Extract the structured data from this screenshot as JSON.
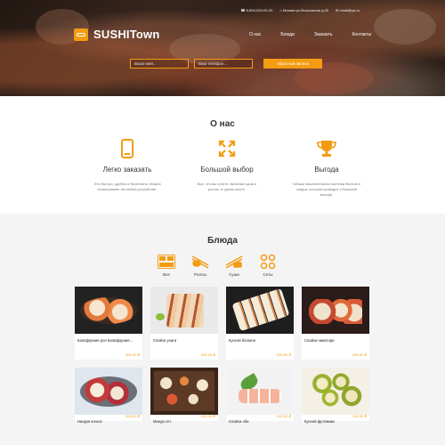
{
  "header": {
    "phone": "8-800-000-00-00",
    "address": "Москва ул.Московская д.00",
    "email": "email@ya.ru",
    "logo_text": "SUSHITown",
    "nav": [
      "О нас",
      "Блюда",
      "Заказать",
      "Контакты"
    ],
    "name_placeholder": "Ваше имя...",
    "phone_placeholder": "Ваш телефон...",
    "callback_button": "обратный звонок"
  },
  "about": {
    "title": "О нас",
    "features": [
      {
        "icon": "phone-icon",
        "title": "Легко заказать",
        "text": "Это быстро, удобно и бесплатно. Можно использовать на любом устройстве."
      },
      {
        "icon": "expand-arrows-icon",
        "title": "Большой выбор",
        "text": "Все, что вы хотите, включая суши и роллы, в одном месте."
      },
      {
        "icon": "trophy-icon",
        "title": "Выгода",
        "text": "Гибкая накопительная система баллов и скидок, которая приводит к большей выгоде."
      }
    ]
  },
  "dishes": {
    "title": "Блюда",
    "categories": [
      {
        "icon": "all-dishes-icon",
        "label": "Все"
      },
      {
        "icon": "rolls-chopsticks-icon",
        "label": "Роллы"
      },
      {
        "icon": "sushi-chopsticks-icon",
        "label": "Суши"
      },
      {
        "icon": "sets-icon",
        "label": "Сеты"
      }
    ],
    "items": [
      {
        "name": "Калифорния рол Калифорния...",
        "price": "000.00 ₽"
      },
      {
        "name": "Спайси унаги",
        "price": "000.00 ₽"
      },
      {
        "name": "Кунсей батакон",
        "price": "000.00 ₽"
      },
      {
        "name": "Спайси ниватори",
        "price": "000.00 ₽"
      },
      {
        "name": "Ниндзя когасе",
        "price": "000.00 ₽"
      },
      {
        "name": "Миндо сет",
        "price": "000.00 ₽"
      },
      {
        "name": "Спайси эби",
        "price": "000.00 ₽"
      },
      {
        "name": "Кунсей футомаки",
        "price": "000.00 ₽"
      }
    ]
  },
  "colors": {
    "accent": "#f39c12",
    "hero_dark": "#2a1e18",
    "section_gray": "#f4f4f4"
  }
}
